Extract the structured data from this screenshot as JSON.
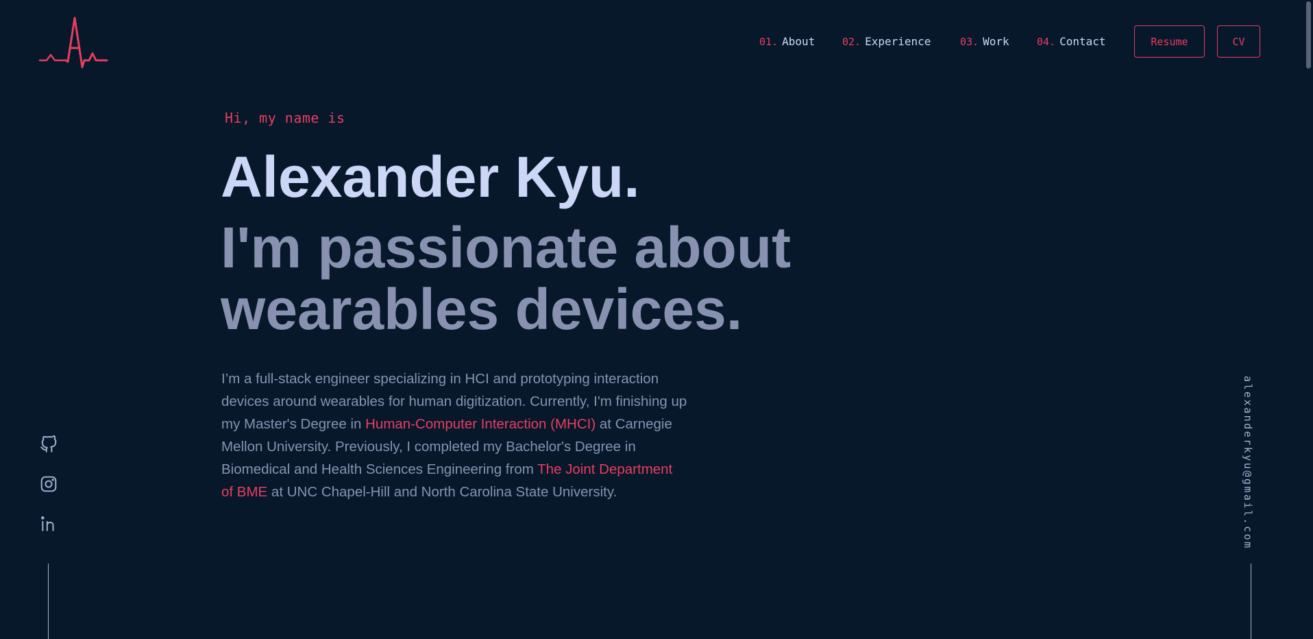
{
  "brand": {
    "logo_letter": "A",
    "accent": "#e83e5f",
    "background": "#07182b"
  },
  "nav": {
    "items": [
      {
        "num": "01.",
        "label": "About"
      },
      {
        "num": "02.",
        "label": "Experience"
      },
      {
        "num": "03.",
        "label": "Work"
      },
      {
        "num": "04.",
        "label": "Contact"
      }
    ],
    "resume_label": "Resume",
    "cv_label": "CV"
  },
  "hero": {
    "greeting": "Hi, my name is",
    "name": "Alexander Kyu.",
    "tagline": "I'm passionate about wearables devices.",
    "bio": {
      "part1": "I’m a full-stack engineer specializing in HCI and prototyping interaction devices around wearables for human digitization. Currently, I'm finishing up my Master's Degree in",
      "link1": "Human-Computer Interaction (MHCI)",
      "part2": "at Carnegie Mellon University. Previously, I completed my Bachelor's Degree in Biomedical and Health Sciences Engineering from",
      "link2": "The Joint Department of BME",
      "part3": "at UNC Chapel-Hill and North Carolina State University."
    }
  },
  "social": {
    "icons": [
      "github-icon",
      "instagram-icon",
      "linkedin-icon"
    ]
  },
  "email": "alexanderkyu@gmail.com"
}
